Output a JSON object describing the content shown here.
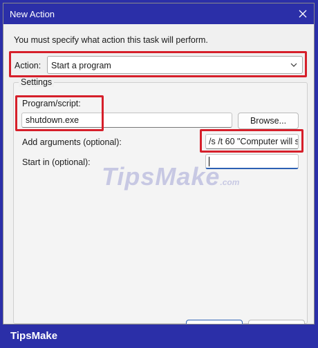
{
  "window": {
    "title": "New Action"
  },
  "instruction": "You must specify what action this task will perform.",
  "action": {
    "label": "Action:",
    "value": "Start a program"
  },
  "settings": {
    "label": "Settings",
    "program": {
      "label": "Program/script:",
      "value": "shutdown.exe",
      "browse_label": "Browse..."
    },
    "arguments": {
      "label": "Add arguments (optional):",
      "value": "/s /t 60 \"Computer will s"
    },
    "start_in": {
      "label": "Start in (optional):",
      "value": ""
    }
  },
  "watermark": {
    "main": "TipsMake",
    "suffix": ".com"
  },
  "footer": {
    "brand": "TipsMake"
  },
  "colors": {
    "accent": "#2b2fa8",
    "highlight": "#d61f2a"
  }
}
